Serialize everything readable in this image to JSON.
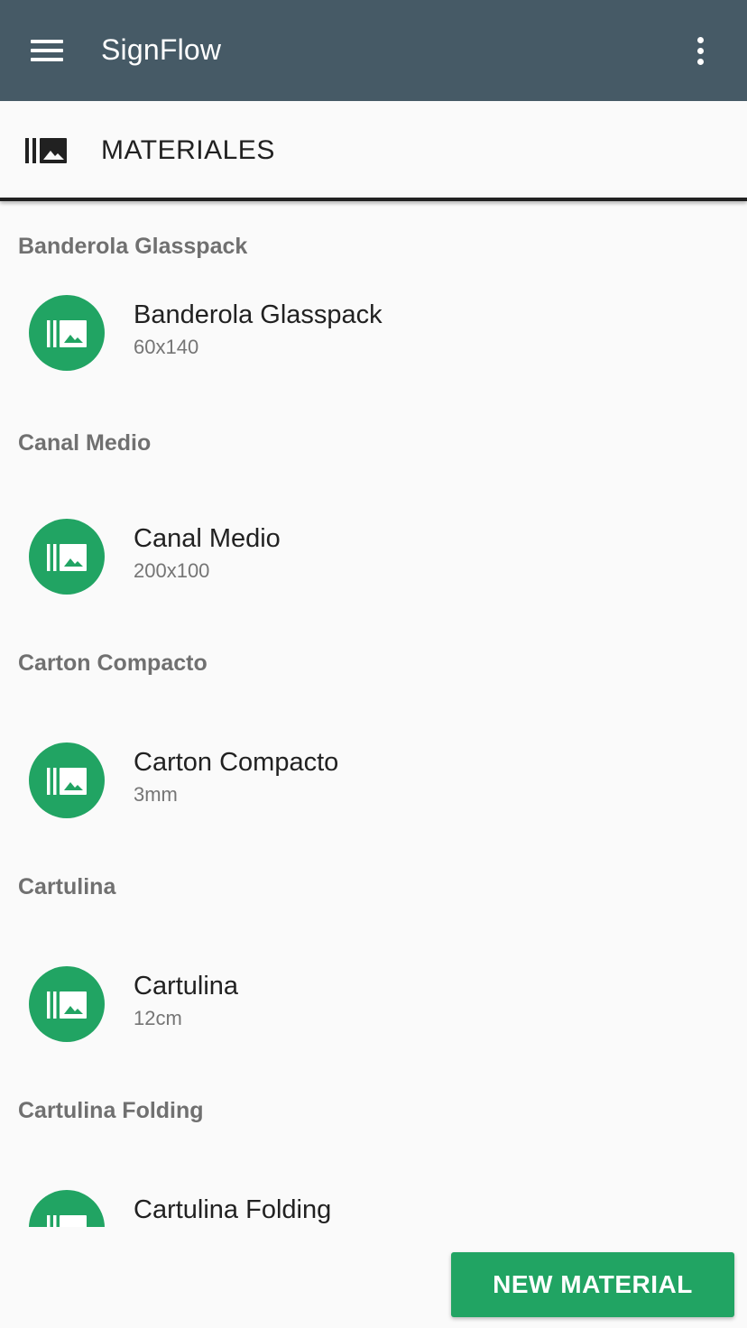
{
  "appbar": {
    "title": "SignFlow",
    "menu_icon": "hamburger-menu-icon",
    "more_icon": "more-vertical-icon"
  },
  "section": {
    "title": "MATERIALES",
    "icon": "materials-library-icon"
  },
  "materials": [
    {
      "group": "Banderola Glasspack",
      "name": "Banderola Glasspack",
      "size": "60x140"
    },
    {
      "group": "Canal Medio",
      "name": "Canal Medio",
      "size": "200x100"
    },
    {
      "group": "Carton Compacto",
      "name": "Carton Compacto",
      "size": "3mm"
    },
    {
      "group": "Cartulina",
      "name": "Cartulina",
      "size": "12cm"
    },
    {
      "group": "Cartulina Folding",
      "name": "Cartulina Folding",
      "size": ""
    }
  ],
  "actions": {
    "new_material_label": "NEW MATERIAL"
  },
  "colors": {
    "appbar": "#465a66",
    "accent": "#21a463",
    "background": "#fafafa"
  }
}
